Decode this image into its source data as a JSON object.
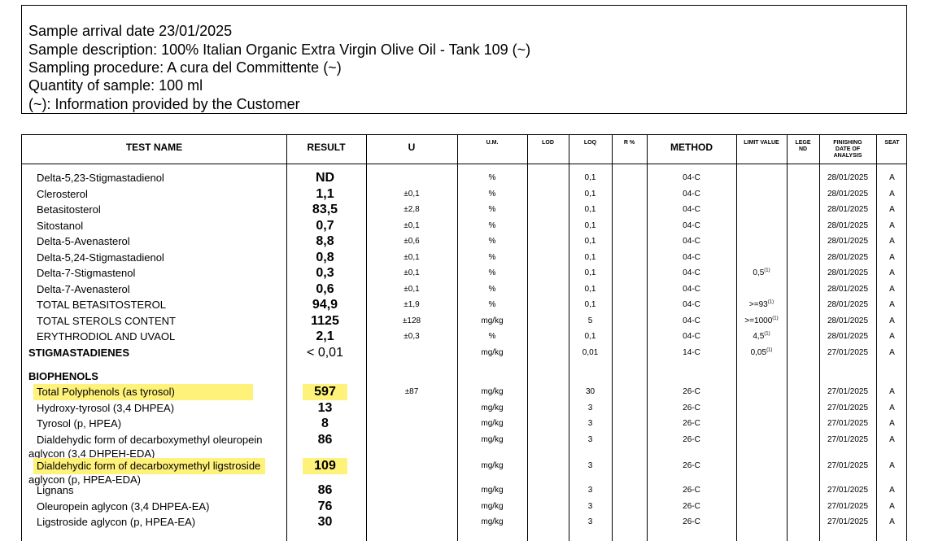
{
  "info": {
    "arrival": "Sample arrival date 23/01/2025",
    "description": "Sample description: 100% Italian Organic Extra Virgin Olive Oil  - Tank 109 (~)",
    "procedure": "Sampling procedure: A cura del Committente (~)",
    "quantity": "Quantity of sample: 100 ml",
    "note": "(~): Information provided by the Customer"
  },
  "headers": {
    "test_name": "TEST NAME",
    "result": "RESULT",
    "u": "U",
    "um": "U.M.",
    "lod": "LOD",
    "loq": "LOQ",
    "r": "R %",
    "method": "METHOD",
    "limit": "LIMIT VALUE",
    "legend_1": "LEGE",
    "legend_2": "ND",
    "finishing_1": "FINISHING",
    "finishing_2": "DATE OF",
    "finishing_3": "ANALYSIS",
    "seat": "SEAT"
  },
  "colors": {
    "highlight": "#fff27a"
  },
  "rows": [
    {
      "name": "Delta-5,23-Stigmastadienol",
      "result": "ND",
      "u": "",
      "um": "%",
      "loq": "0,1",
      "method": "04-C",
      "limit": "",
      "date": "28/01/2025",
      "seat": "A"
    },
    {
      "name": "Clerosterol",
      "result": "1,1",
      "u": "±0,1",
      "um": "%",
      "loq": "0,1",
      "method": "04-C",
      "limit": "",
      "date": "28/01/2025",
      "seat": "A"
    },
    {
      "name": "Betasitosterol",
      "result": "83,5",
      "u": "±2,8",
      "um": "%",
      "loq": "0,1",
      "method": "04-C",
      "limit": "",
      "date": "28/01/2025",
      "seat": "A"
    },
    {
      "name": "Sitostanol",
      "result": "0,7",
      "u": "±0,1",
      "um": "%",
      "loq": "0,1",
      "method": "04-C",
      "limit": "",
      "date": "28/01/2025",
      "seat": "A"
    },
    {
      "name": "Delta-5-Avenasterol",
      "result": "8,8",
      "u": "±0,6",
      "um": "%",
      "loq": "0,1",
      "method": "04-C",
      "limit": "",
      "date": "28/01/2025",
      "seat": "A"
    },
    {
      "name": "Delta-5,24-Stigmastadienol",
      "result": "0,8",
      "u": "±0,1",
      "um": "%",
      "loq": "0,1",
      "method": "04-C",
      "limit": "",
      "date": "28/01/2025",
      "seat": "A"
    },
    {
      "name": "Delta-7-Stigmastenol",
      "result": "0,3",
      "u": "±0,1",
      "um": "%",
      "loq": "0,1",
      "method": "04-C",
      "limit": "0,5",
      "date": "28/01/2025",
      "seat": "A"
    },
    {
      "name": "Delta-7-Avenasterol",
      "result": "0,6",
      "u": "±0,1",
      "um": "%",
      "loq": "0,1",
      "method": "04-C",
      "limit": "",
      "date": "28/01/2025",
      "seat": "A"
    },
    {
      "name": "TOTAL BETASITOSTEROL",
      "result": "94,9",
      "u": "±1,9",
      "um": "%",
      "loq": "0,1",
      "method": "04-C",
      "limit": ">=93",
      "date": "28/01/2025",
      "seat": "A"
    },
    {
      "name": "TOTAL STEROLS CONTENT",
      "result": "1125",
      "u": "±128",
      "um": "mg/kg",
      "loq": "5",
      "method": "04-C",
      "limit": ">=1000",
      "date": "28/01/2025",
      "seat": "A"
    },
    {
      "name": "ERYTHRODIOL AND UVAOL",
      "result": "2,1",
      "u": "±0,3",
      "um": "%",
      "loq": "0,1",
      "method": "04-C",
      "limit": "4,5",
      "date": "28/01/2025",
      "seat": "A"
    },
    {
      "name": "STIGMASTADIENES",
      "result": "< 0,01",
      "u": "",
      "um": "mg/kg",
      "loq": "0,01",
      "method": "14-C",
      "limit": "0,05",
      "date": "27/01/2025",
      "seat": "A"
    },
    {
      "name": "BIOPHENOLS"
    },
    {
      "name": "Total Polyphenols (as tyrosol)",
      "result": "597",
      "u": "±87",
      "um": "mg/kg",
      "loq": "30",
      "method": "26-C",
      "limit": "",
      "date": "27/01/2025",
      "seat": "A"
    },
    {
      "name": "Hydroxy-tyrosol (3,4 DHPEA)",
      "result": "13",
      "u": "",
      "um": "mg/kg",
      "loq": "3",
      "method": "26-C",
      "limit": "",
      "date": "27/01/2025",
      "seat": "A"
    },
    {
      "name": "Tyrosol (p, HPEA)",
      "result": "8",
      "u": "",
      "um": "mg/kg",
      "loq": "3",
      "method": "26-C",
      "limit": "",
      "date": "27/01/2025",
      "seat": "A"
    },
    {
      "name": "Dialdehydic form of decarboxymethyl oleuropein",
      "name2": "aglycon (3,4 DHPEH-EDA)",
      "result": "86",
      "u": "",
      "um": "mg/kg",
      "loq": "3",
      "method": "26-C",
      "limit": "",
      "date": "27/01/2025",
      "seat": "A"
    },
    {
      "name": "Dialdehydic form of decarboxymethyl ligstroside",
      "name2": "aglycon (p, HPEA-EDA)",
      "result": "109",
      "u": "",
      "um": "mg/kg",
      "loq": "3",
      "method": "26-C",
      "limit": "",
      "date": "27/01/2025",
      "seat": "A"
    },
    {
      "name": "Lignans",
      "result": "86",
      "u": "",
      "um": "mg/kg",
      "loq": "3",
      "method": "26-C",
      "limit": "",
      "date": "27/01/2025",
      "seat": "A"
    },
    {
      "name": "Oleuropein aglycon (3,4 DHPEA-EA)",
      "result": "76",
      "u": "",
      "um": "mg/kg",
      "loq": "3",
      "method": "26-C",
      "limit": "",
      "date": "27/01/2025",
      "seat": "A"
    },
    {
      "name": "Ligstroside aglycon (p, HPEA-EA)",
      "result": "30",
      "u": "",
      "um": "mg/kg",
      "loq": "3",
      "method": "26-C",
      "limit": "",
      "date": "27/01/2025",
      "seat": "A"
    }
  ],
  "footnote_marker": "(1)"
}
